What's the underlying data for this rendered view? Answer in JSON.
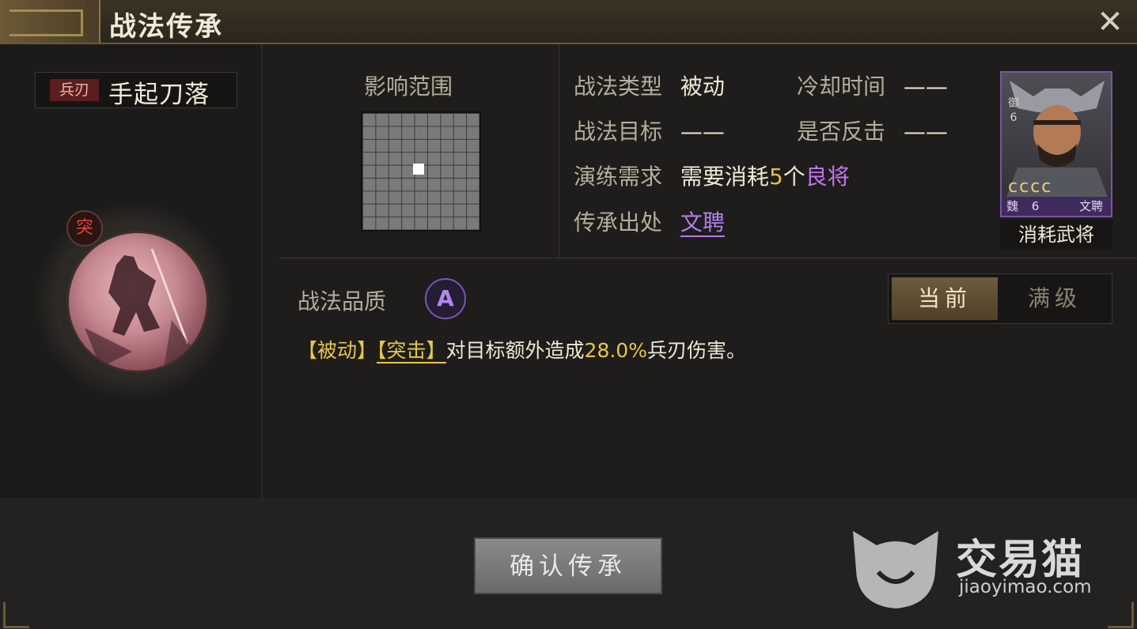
{
  "window": {
    "title": "战法传承",
    "close_icon": "close-icon"
  },
  "skill": {
    "tag": "兵刃",
    "name": "手起刀落",
    "badge": "突"
  },
  "range": {
    "label": "影响范围",
    "grid_size": 9,
    "active_cell": [
      4,
      4
    ]
  },
  "info": {
    "type_label": "战法类型",
    "type_value": "被动",
    "cooldown_label": "冷却时间",
    "cooldown_value": "——",
    "target_label": "战法目标",
    "target_value": "——",
    "counter_label": "是否反击",
    "counter_value": "——",
    "req_label": "演练需求",
    "req_prefix": "需要消耗",
    "req_count": "5",
    "req_unit": "个",
    "req_quality": "良将",
    "source_label": "传承出处",
    "source_value": "文聘"
  },
  "hero": {
    "defense_char": "御",
    "defense_val": "6",
    "stars": "cccc",
    "faction": "魏",
    "level": "6",
    "name": "文聘",
    "consume_label": "消耗武将",
    "border_color": "#7a53a8"
  },
  "quality": {
    "label": "战法品质",
    "grade": "A"
  },
  "toggle": {
    "current": "当前",
    "max": "满级"
  },
  "description": {
    "part1": "【被动】",
    "part2": "【突击】",
    "part3": "对目标额外造成",
    "pct": "28.0%",
    "part4": "兵刃伤害。"
  },
  "confirm_button": "确认传承",
  "watermark": {
    "cn": "交易猫",
    "url": "jiaoyimao.com"
  },
  "colors": {
    "accent_gold": "#e6c64c",
    "accent_purple": "#b27de8"
  }
}
